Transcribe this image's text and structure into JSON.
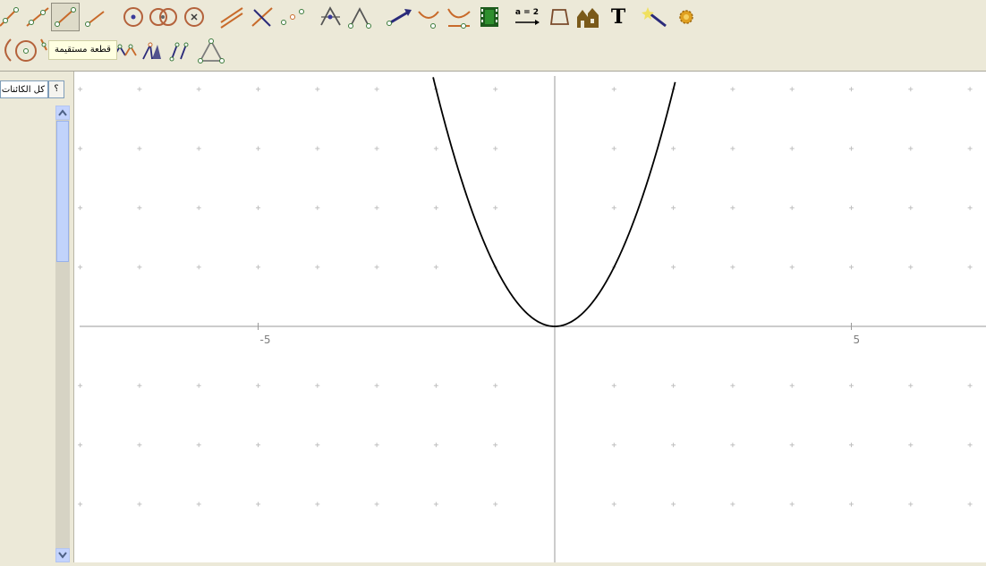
{
  "toolbar": {
    "row1_tools": [
      "point-on-line-icon",
      "segment-icon",
      "segment-selected-icon",
      "vector-icon",
      "circle-center-point-icon",
      "circle-three-points-icon",
      "circle-radius-icon",
      "parallel-line-icon",
      "perpendicular-line-icon",
      "points-sequence-icon",
      "triangle-points-icon",
      "angle-icon",
      "arrow-icon",
      "curve-icon",
      "locus-icon",
      "animation-film-icon",
      "slider-icon",
      "polygon-icon",
      "house-image-icon",
      "text-icon",
      "magic-wand-icon",
      "settings-gear-icon"
    ],
    "slider_label": "a = 2",
    "text_tool_label": "T",
    "tooltip": "قطعة مستقيمة",
    "row2_tools": [
      "arc-icon",
      "circle-icon",
      "tangent-icon",
      "transform-icon",
      "reflect-icon",
      "dilate-icon",
      "triangle-icon"
    ]
  },
  "left_panel": {
    "combo_value": "كل الكائنات",
    "combo_button": "؟"
  },
  "graph": {
    "x_tick_labels": [
      "-5",
      "5"
    ],
    "function": "y = x^2",
    "colors": {
      "curve": "#000000",
      "axis": "#999999",
      "grid": "#c0c0c0"
    }
  }
}
